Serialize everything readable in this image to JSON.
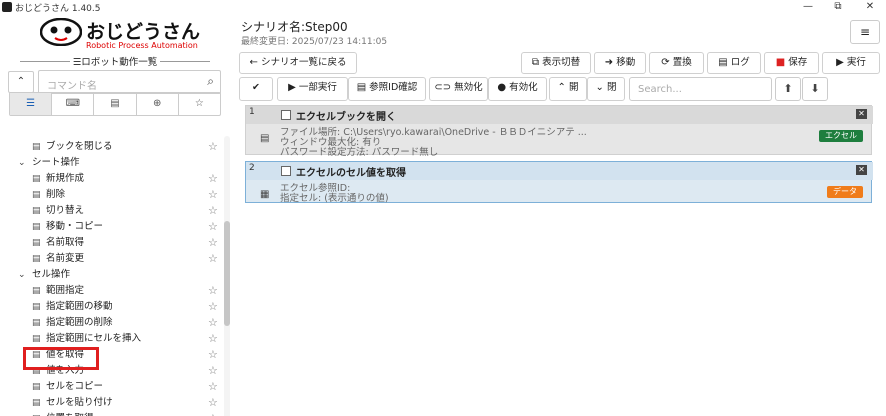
{
  "window": {
    "title": "おじどうさん 1.40.5",
    "minimize": "—",
    "restore": "⧉",
    "close": "✕"
  },
  "logo": {
    "title": "おじどうさん",
    "subtitle": "Robotic Process Automation"
  },
  "left_panel": {
    "section_title": "☰ロボット動作一覧",
    "collapse_icon": "⌃",
    "search_placeholder": "コマンド名",
    "search_icon": "⌕",
    "category_tabs": [
      {
        "name": "list-icon",
        "glyph": "☰"
      },
      {
        "name": "keyboard-icon",
        "glyph": "⌨"
      },
      {
        "name": "file-icon",
        "glyph": "▤"
      },
      {
        "name": "globe-icon",
        "glyph": "⊕"
      },
      {
        "name": "star-icon",
        "glyph": "☆"
      }
    ],
    "tree": [
      {
        "type": "item",
        "label": "ブックを閉じる"
      },
      {
        "type": "group",
        "label": "シート操作"
      },
      {
        "type": "item",
        "label": "新規作成"
      },
      {
        "type": "item",
        "label": "削除"
      },
      {
        "type": "item",
        "label": "切り替え"
      },
      {
        "type": "item",
        "label": "移動・コピー"
      },
      {
        "type": "item",
        "label": "名前取得"
      },
      {
        "type": "item",
        "label": "名前変更"
      },
      {
        "type": "group",
        "label": "セル操作"
      },
      {
        "type": "item",
        "label": "範囲指定"
      },
      {
        "type": "item",
        "label": "指定範囲の移動"
      },
      {
        "type": "item",
        "label": "指定範囲の削除"
      },
      {
        "type": "item",
        "label": "指定範囲にセルを挿入"
      },
      {
        "type": "item",
        "label": "値を取得"
      },
      {
        "type": "item",
        "label": "値を入力"
      },
      {
        "type": "item",
        "label": "セルをコピー"
      },
      {
        "type": "item",
        "label": "セルを貼り付け"
      },
      {
        "type": "item",
        "label": "位置を取得"
      }
    ]
  },
  "header": {
    "scenario_name": "シナリオ名:Step00",
    "last_modified": "最終変更日: 2025/07/23 14:11:05",
    "menu_icon": "≡"
  },
  "toolbar1": {
    "back": "シナリオ一覧に戻る",
    "toggle_view": "表示切替",
    "move": "移動",
    "replace": "置換",
    "log": "ログ",
    "save": "保存",
    "run": "実行"
  },
  "toolbar2": {
    "partial_run": "一部実行",
    "ref_id_check": "参照ID確認",
    "disable": "無効化",
    "enable": "有効化",
    "open": "開",
    "close": "閉",
    "search_placeholder": "Search..."
  },
  "steps": [
    {
      "number": "1",
      "title": "エクセルブックを開く",
      "details": [
        "ファイル場所: C:\\Users\\ryo.kawarai\\OneDrive - ＢＢＤイニシアテ ...",
        "ウィンドウ最大化: 有り",
        "パスワード設定方法: パスワード無し"
      ],
      "tag": "エクセル",
      "tag_color": "#1e7e3e"
    },
    {
      "number": "2",
      "title": "エクセルのセル値を取得",
      "details": [
        "エクセル参照ID:",
        "指定セル: (表示通りの値)"
      ],
      "tag": "データ",
      "tag_color": "#f07c1a"
    }
  ]
}
